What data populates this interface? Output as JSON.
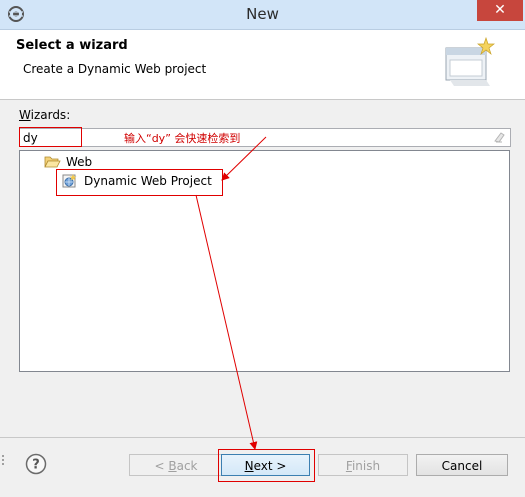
{
  "window": {
    "title": "New",
    "close_glyph": "✕"
  },
  "banner": {
    "title": "Select a wizard",
    "description": "Create a Dynamic Web project",
    "icon": "wizard-banner-icon"
  },
  "wizards": {
    "label_accel": "W",
    "label_rest": "izards:",
    "filter_value": "dy",
    "annotation": "输入“dy” 会快速检索到",
    "tree": [
      {
        "label": "Web",
        "icon": "folder-open-icon",
        "expanded": true
      },
      {
        "label": "Dynamic Web Project",
        "icon": "dynamic-web-project-icon",
        "selected": false
      }
    ]
  },
  "buttons": {
    "back": {
      "pre": "< ",
      "accel": "B",
      "post": "ack"
    },
    "next": {
      "pre": "",
      "accel": "N",
      "post": "ext >"
    },
    "finish": {
      "pre": "",
      "accel": "F",
      "post": "inish"
    },
    "cancel": "Cancel"
  },
  "colors": {
    "annotation": "#d00000",
    "titlebar": "#d2e5f8",
    "close": "#c7463d"
  }
}
